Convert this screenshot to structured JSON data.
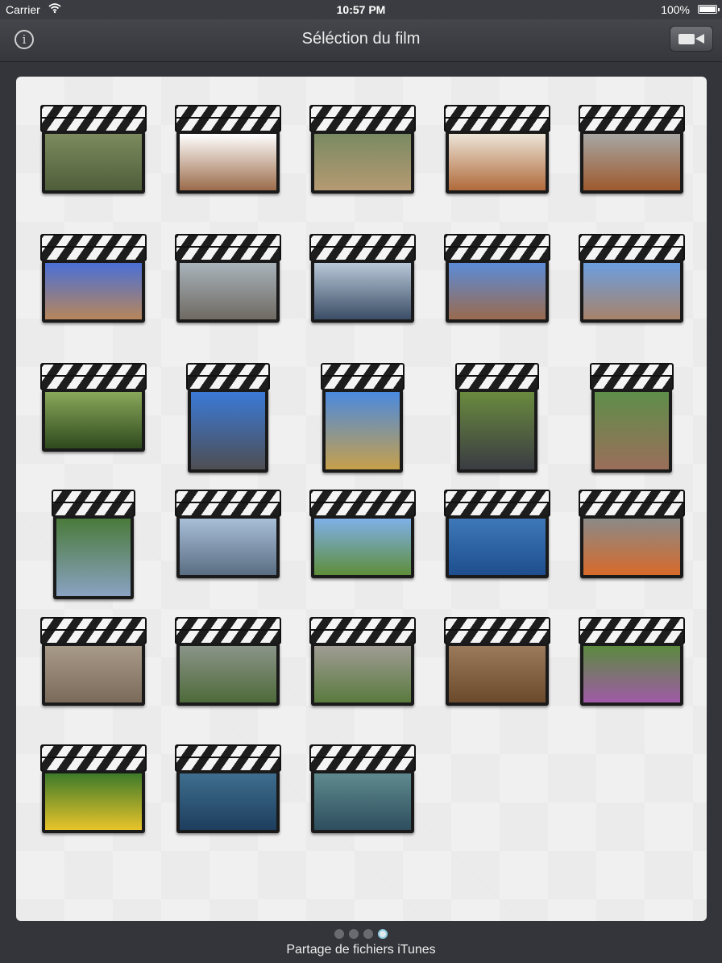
{
  "status_bar": {
    "carrier": "Carrier",
    "time": "10:57 PM",
    "battery": "100%"
  },
  "nav": {
    "title": "Séléction du film",
    "info_icon": "info-icon",
    "camera_icon": "video-camera-icon"
  },
  "clips": [
    {
      "thumb": "garden-path",
      "colors": [
        "#7c8a5e",
        "#4f5e3a"
      ]
    },
    {
      "thumb": "spaniel-dog",
      "colors": [
        "#ffffff",
        "#9b6b4a"
      ]
    },
    {
      "thumb": "olive-trees",
      "colors": [
        "#7a8a62",
        "#b59a72"
      ]
    },
    {
      "thumb": "puppies-bed",
      "colors": [
        "#ece4d8",
        "#b06a3a"
      ]
    },
    {
      "thumb": "boxer-puppy",
      "colors": [
        "#a7a7a4",
        "#9e5a2e"
      ]
    },
    {
      "thumb": "groundhog",
      "colors": [
        "#4a6fd6",
        "#b7865a"
      ]
    },
    {
      "thumb": "balcony-view",
      "colors": [
        "#a8b3bb",
        "#6f6a62"
      ]
    },
    {
      "thumb": "sea-sunset",
      "colors": [
        "#b9c8d8",
        "#3b4d66"
      ]
    },
    {
      "thumb": "town-roofs",
      "colors": [
        "#5b8cd8",
        "#9a6a4e"
      ]
    },
    {
      "thumb": "town-skyline",
      "colors": [
        "#6b9ee0",
        "#a7836a"
      ]
    },
    {
      "thumb": "green-plants",
      "colors": [
        "#8aa85a",
        "#2e4a1e"
      ]
    },
    {
      "thumb": "parking-lot",
      "colors": [
        "#3b7ad8",
        "#4e4e52"
      ]
    },
    {
      "thumb": "palm-street",
      "colors": [
        "#4a8ae0",
        "#c7a04a"
      ]
    },
    {
      "thumb": "parked-car",
      "colors": [
        "#6a8a3e",
        "#3a3c42"
      ]
    },
    {
      "thumb": "race-track",
      "colors": [
        "#5e8e4a",
        "#9a6e5a"
      ]
    },
    {
      "thumb": "tree-path",
      "colors": [
        "#4a7a3a",
        "#8aa2c2"
      ]
    },
    {
      "thumb": "beach-sea",
      "colors": [
        "#a8bfd8",
        "#5a6d82"
      ]
    },
    {
      "thumb": "kids-field",
      "colors": [
        "#7fb0e8",
        "#5e8e3a"
      ]
    },
    {
      "thumb": "blue-sea",
      "colors": [
        "#3e78b8",
        "#1e4e8e"
      ]
    },
    {
      "thumb": "kids-playing",
      "colors": [
        "#8a8a88",
        "#d86a2a"
      ]
    },
    {
      "thumb": "kids-rocks",
      "colors": [
        "#a89a88",
        "#7a6a5a"
      ]
    },
    {
      "thumb": "red-panda-rocks",
      "colors": [
        "#8a9488",
        "#4e6a3a"
      ]
    },
    {
      "thumb": "red-panda-zoo",
      "colors": [
        "#a09c94",
        "#5a7a3e"
      ]
    },
    {
      "thumb": "mongoose",
      "colors": [
        "#9a7a5a",
        "#6a4a2a"
      ]
    },
    {
      "thumb": "butterfly-flowers",
      "colors": [
        "#5a8a3e",
        "#a05aa8"
      ]
    },
    {
      "thumb": "butterfly-yellow",
      "colors": [
        "#3e7a2a",
        "#e8c42a"
      ]
    },
    {
      "thumb": "aquarium-shark",
      "colors": [
        "#3e6e8e",
        "#1e3e5e"
      ]
    },
    {
      "thumb": "aquarium-fish",
      "colors": [
        "#5e8a8e",
        "#2e4e5e"
      ]
    }
  ],
  "pager": {
    "pages": 4,
    "active": 4
  },
  "footer": {
    "label": "Partage de fichiers iTunes"
  }
}
